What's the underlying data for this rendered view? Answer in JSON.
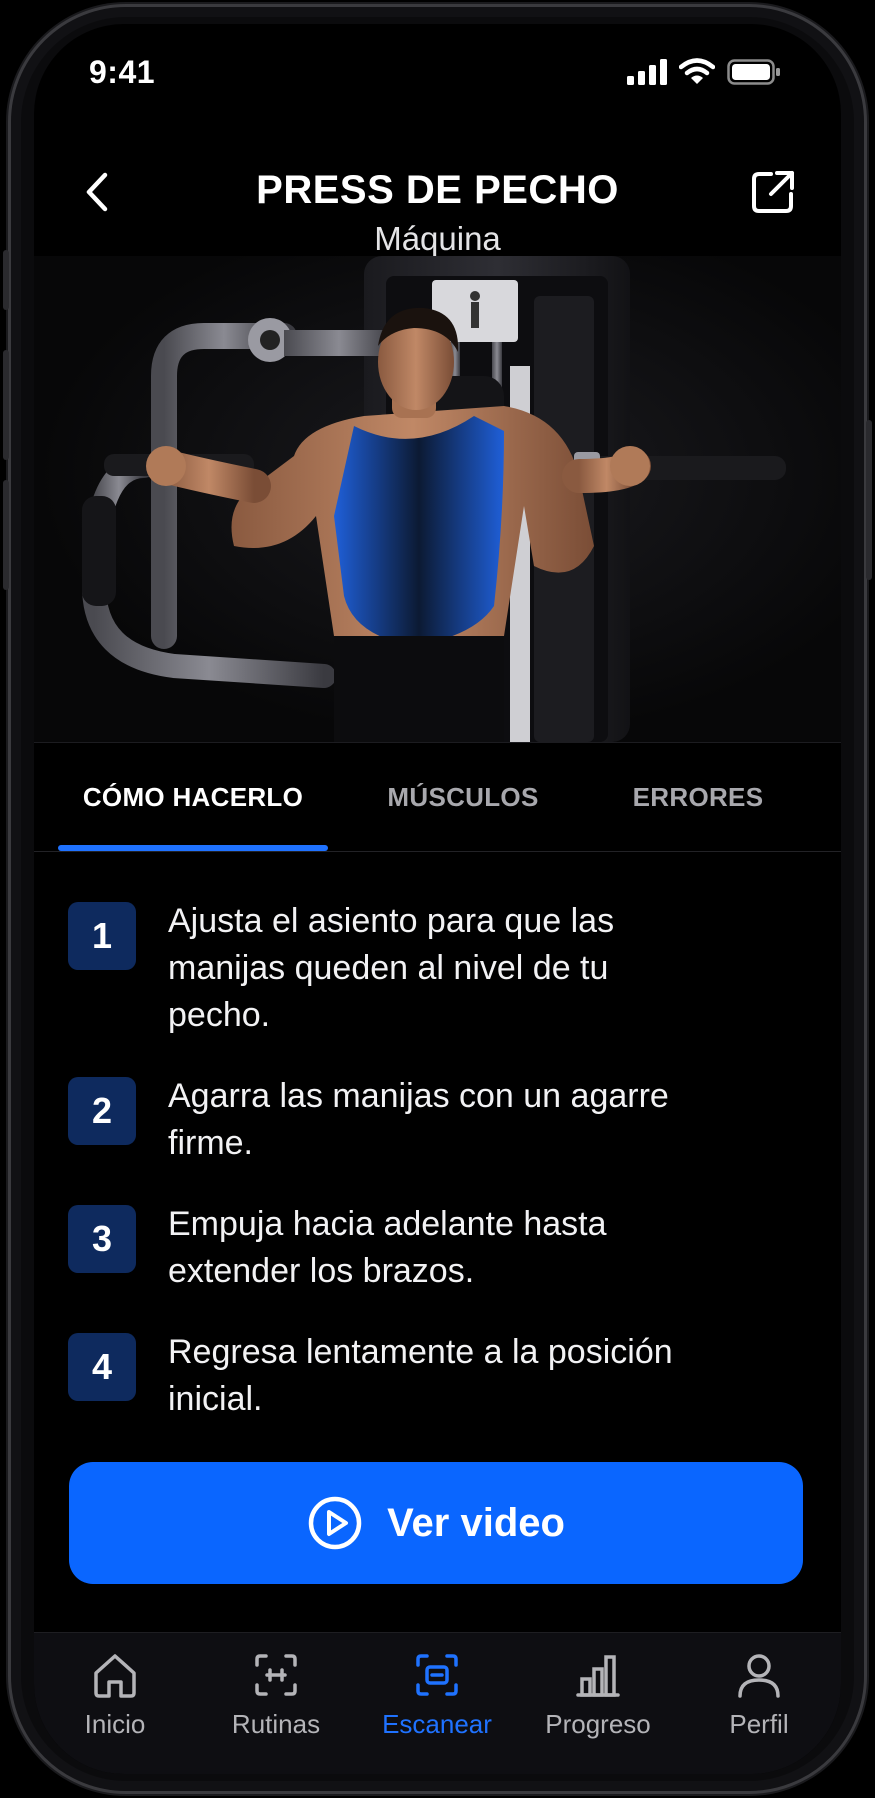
{
  "status_bar": {
    "time": "9:41"
  },
  "header": {
    "title": "PRESS DE PECHO",
    "subtitle": "Máquina"
  },
  "hero": {
    "image": "man-using-chest-press-machine"
  },
  "tabs": [
    {
      "label": "CÓMO HACERLO",
      "active": true
    },
    {
      "label": "MÚSCULOS",
      "active": false
    },
    {
      "label": "ERRORES",
      "active": false
    }
  ],
  "steps": [
    {
      "number": "1",
      "text": "Ajusta el asiento para que las manijas queden al nivel de tu pecho."
    },
    {
      "number": "2",
      "text": "Agarra las manijas con un agarre firme."
    },
    {
      "number": "3",
      "text": "Empuja hacia adelante hasta extender los brazos."
    },
    {
      "number": "4",
      "text": "Regresa lentamente a la posición inicial."
    }
  ],
  "cta": {
    "label": "Ver video",
    "icon": "play-circle-icon"
  },
  "nav": [
    {
      "label": "Inicio",
      "icon": "home-icon",
      "active": false
    },
    {
      "label": "Rutinas",
      "icon": "routines-icon",
      "active": false
    },
    {
      "label": "Escanear",
      "icon": "scan-icon",
      "active": true
    },
    {
      "label": "Progreso",
      "icon": "progress-chart-icon",
      "active": false
    },
    {
      "label": "Perfil",
      "icon": "profile-icon",
      "active": false
    }
  ],
  "colors": {
    "accent": "#0a66ff",
    "step_badge": "#0e2a5e",
    "background": "#000000",
    "nav_bg": "#0e0e12"
  }
}
